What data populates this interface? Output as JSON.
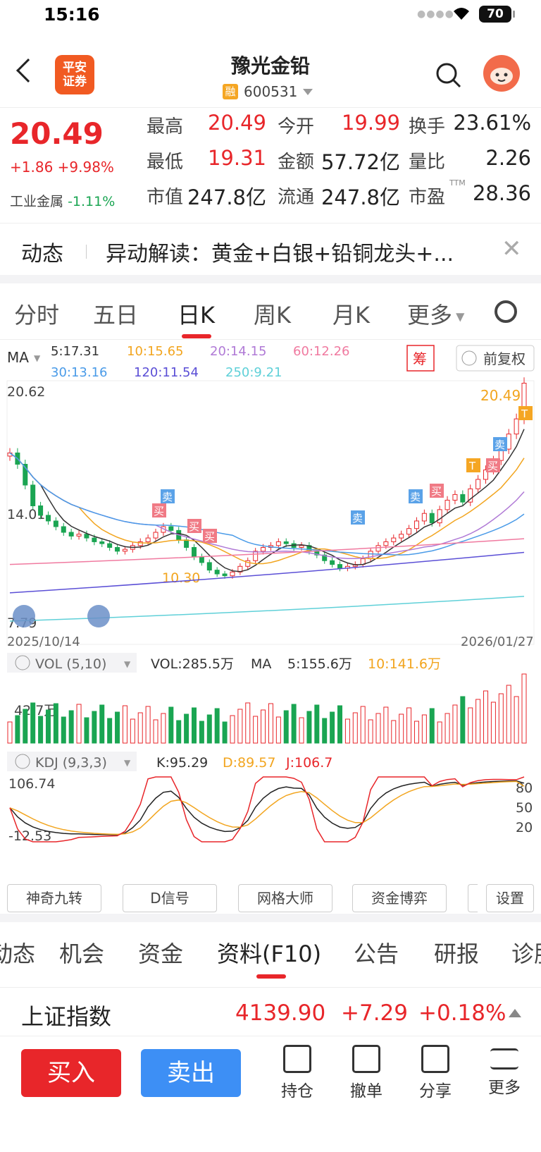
{
  "status": {
    "time": "15:16",
    "battery": "70"
  },
  "header": {
    "logo_line1": "平安",
    "logo_line2": "证券",
    "title": "豫光金铅",
    "badge": "融",
    "code": "600531"
  },
  "quote": {
    "price": "20.49",
    "change": "+1.86 +9.98%",
    "industry_label": "工业金属",
    "industry_change": "-1.11%",
    "fields": [
      {
        "label": "最高",
        "value": "20.49",
        "color": "#e8262a"
      },
      {
        "label": "今开",
        "value": "19.99",
        "color": "#e8262a"
      },
      {
        "label": "换手",
        "value": "23.61%",
        "color": "#222222"
      },
      {
        "label": "最低",
        "value": "19.31",
        "color": "#e8262a"
      },
      {
        "label": "金额",
        "value": "57.72亿",
        "color": "#222222"
      },
      {
        "label": "量比",
        "value": "2.26",
        "color": "#222222"
      },
      {
        "label": "市值",
        "value": "247.8亿",
        "color": "#222222"
      },
      {
        "label": "流通",
        "value": "247.8亿",
        "color": "#222222"
      },
      {
        "label": "市盈",
        "value": "28.36",
        "color": "#222222"
      }
    ],
    "ttm": "TTM"
  },
  "news": {
    "tag": "动态",
    "text": "异动解读：黄金+白银+铅铜龙头+..."
  },
  "tabs": [
    "分时",
    "五日",
    "日K",
    "周K",
    "月K",
    "更多"
  ],
  "chart": {
    "ma_label": "MA",
    "ma_items": [
      {
        "text": "5:17.31",
        "color": "#333333"
      },
      {
        "text": "10:15.65",
        "color": "#f2a51f"
      },
      {
        "text": "20:14.15",
        "color": "#b07ad6"
      },
      {
        "text": "60:12.26",
        "color": "#f07aa0"
      },
      {
        "text": "30:13.16",
        "color": "#4a9be8"
      },
      {
        "text": "120:11.54",
        "color": "#5b4fd6"
      },
      {
        "text": "250:9.21",
        "color": "#5fd0d8"
      }
    ],
    "chou": "筹",
    "fuquan": "前复权",
    "y_top": "20.62",
    "y_mid": "14.01",
    "y_bot": "7.79",
    "last_price_label": "20.49",
    "low_label": "10.30",
    "date_start": "2025/10/14",
    "date_end": "2026/01/27",
    "vol_header": "VOL (5,10)",
    "vol_value": "VOL:285.5万",
    "vol_ma": "MA",
    "vol_ma5": "5:155.6万",
    "vol_ma10": "10:141.6万",
    "vol_scale": "42.7万",
    "kdj_header": "KDJ (9,3,3)",
    "kdj_k": "K:95.29",
    "kdj_d": "D:89.57",
    "kdj_j": "J:106.7",
    "kdj_top": "106.74",
    "kdj_bot": "-12.53",
    "kdj_levels": [
      "80",
      "50",
      "20"
    ],
    "buy_tag": "买",
    "sell_tag": "卖",
    "t_tag": "T"
  },
  "chart_data": {
    "type": "candlestick",
    "x_range": [
      "2025/10/14",
      "2026/01/27"
    ],
    "ylim": [
      7.79,
      20.62
    ],
    "close_approx": [
      16.8,
      16.2,
      15.1,
      14.0,
      13.5,
      13.2,
      12.9,
      12.6,
      12.4,
      12.5,
      12.3,
      12.1,
      12.0,
      11.8,
      11.6,
      11.7,
      11.9,
      12.1,
      12.3,
      12.6,
      12.9,
      12.7,
      12.2,
      11.8,
      11.3,
      11.0,
      10.6,
      10.4,
      10.3,
      10.5,
      10.8,
      11.1,
      11.6,
      11.8,
      11.9,
      12.1,
      12.0,
      11.8,
      11.9,
      11.6,
      11.4,
      11.1,
      10.9,
      10.7,
      10.8,
      10.9,
      11.2,
      11.6,
      11.9,
      12.1,
      12.3,
      12.5,
      12.8,
      13.2,
      13.6,
      13.1,
      13.8,
      14.3,
      14.6,
      14.2,
      14.9,
      15.4,
      15.9,
      16.4,
      17.0,
      17.8,
      18.6,
      20.49
    ],
    "ma_latest": {
      "MA5": 17.31,
      "MA10": 15.65,
      "MA20": 14.15,
      "MA30": 13.16,
      "MA60": 12.26,
      "MA120": 11.54,
      "MA250": 9.21
    },
    "vol": {
      "latest": "285.5万",
      "ma5": "155.6万",
      "ma10": "141.6万"
    },
    "kdj": {
      "K": 95.29,
      "D": 89.57,
      "J": 106.7,
      "ylim": [
        -12.53,
        106.74
      ]
    }
  },
  "buttons": [
    "神奇九转",
    "D信号",
    "网格大师",
    "资金博弈",
    "设置"
  ],
  "bottom_tabs": [
    "动态",
    "机会",
    "资金",
    "资料(F10)",
    "公告",
    "研报",
    "诊股"
  ],
  "index": {
    "name": "上证指数",
    "value": "4139.90",
    "change": "+7.29",
    "pct": "+0.18%"
  },
  "actions": {
    "buy": "买入",
    "sell": "卖出",
    "items": [
      "持仓",
      "撤单",
      "分享",
      "更多"
    ]
  }
}
